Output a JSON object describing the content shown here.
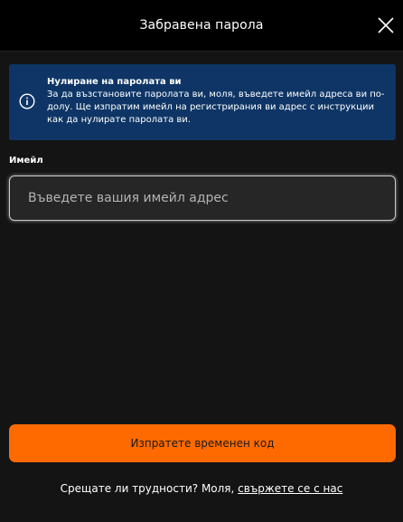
{
  "header": {
    "title": "Забравена парола",
    "close_icon": "close-icon"
  },
  "info": {
    "icon": "info-circle-icon",
    "title": "Нулиране на паролата ви",
    "body": "За да възстановите паролата ви, моля, въведете имейл адреса ви по-долу. Ще изпратим имейл на регистрирания ви адрес с инструкции как да нулирате паролата ви."
  },
  "form": {
    "email_label": "Имейл",
    "email_placeholder": "Въведете вашия имейл адрес",
    "email_value": "",
    "submit_label": "Изпратете временен код"
  },
  "footer": {
    "text": "Срещате ли трудности? Моля, ",
    "link_text": "свържете се с нас"
  },
  "colors": {
    "background": "#141414",
    "header_background": "#000000",
    "info_background": "#0e3565",
    "accent": "#ff6a00"
  }
}
